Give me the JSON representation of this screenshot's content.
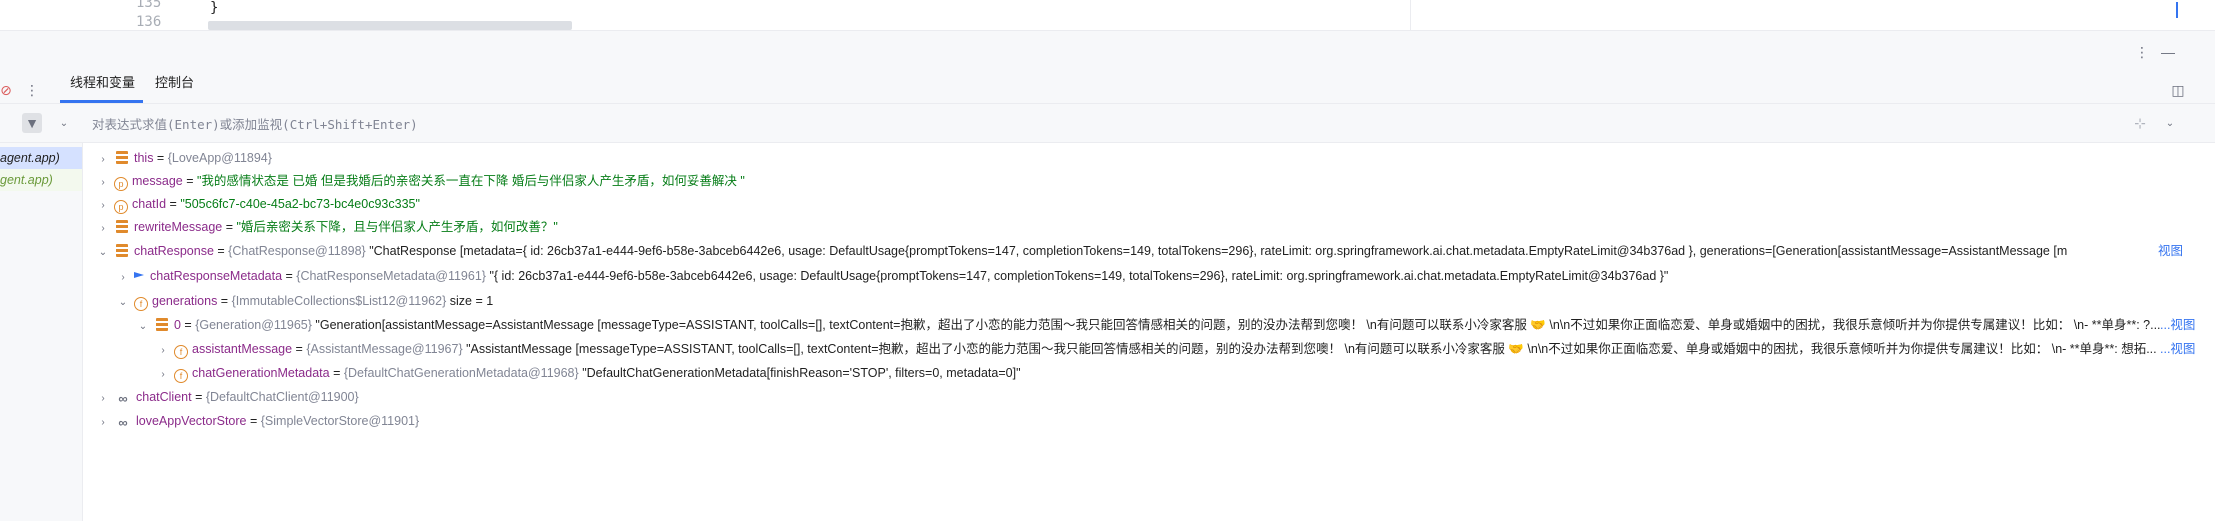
{
  "editor": {
    "line_numbers": [
      "135",
      "136"
    ],
    "code_text": "}"
  },
  "panel": {
    "tabs": [
      {
        "label": "线程和变量",
        "active": true
      },
      {
        "label": "控制台",
        "active": false
      }
    ],
    "expression_placeholder": "对表达式求值(Enter)或添加监视(Ctrl+Shift+Enter)"
  },
  "frames": [
    {
      "label": "agent.app)",
      "selected": true
    },
    {
      "label": "gent.app)",
      "selected": false
    }
  ],
  "variables": [
    {
      "name": "this",
      "type": "{LoveApp@11894}",
      "value": ""
    },
    {
      "name": "message",
      "type": "",
      "value": "\"我的感情状态是 已婚 但是我婚后的亲密关系一直在下降 婚后与伴侣家人产生矛盾，如何妥善解决 \""
    },
    {
      "name": "chatId",
      "type": "",
      "value": "\"505c6fc7-c40e-45a2-bc73-bc4e0c93c335\""
    },
    {
      "name": "rewriteMessage",
      "type": "",
      "value": "\"婚后亲密关系下降，且与伴侣家人产生矛盾，如何改善？\""
    },
    {
      "name": "chatResponse",
      "type": "{ChatResponse@11898}",
      "value": "\"ChatResponse [metadata={ id: 26cb37a1-e444-9ef6-b58e-3abceb6442e6, usage: DefaultUsage{promptTokens=147, completionTokens=149, totalTokens=296}, rateLimit: org.springframework.ai.chat.metadata.EmptyRateLimit@34b376ad }, generations=[Generation[assistantMessage=AssistantMessage [m"
    },
    {
      "name": "chatResponseMetadata",
      "type": "{ChatResponseMetadata@11961}",
      "value": "\"{ id: 26cb37a1-e444-9ef6-b58e-3abceb6442e6, usage: DefaultUsage{promptTokens=147, completionTokens=149, totalTokens=296}, rateLimit: org.springframework.ai.chat.metadata.EmptyRateLimit@34b376ad }\""
    },
    {
      "name": "generations",
      "type": "{ImmutableCollections$List12@11962}",
      "value": "size = 1"
    },
    {
      "name": "0",
      "type": "{Generation@11965}",
      "value": "\"Generation[assistantMessage=AssistantMessage [messageType=ASSISTANT, toolCalls=[], textContent=抱歉，超出了小恋的能力范围～我只能回答情感相关的问题，别的没办法帮到您噢！  \\n有问题可以联系小冷家客服 🤝 \\n\\n不过如果你正面临恋爱、单身或婚姻中的困扰，我很乐意倾听并为你提供专属建议！比如：  \\n- **单身**: ?..."
    },
    {
      "name": "assistantMessage",
      "type": "{AssistantMessage@11967}",
      "value": "\"AssistantMessage [messageType=ASSISTANT, toolCalls=[], textContent=抱歉，超出了小恋的能力范围～我只能回答情感相关的问题，别的没办法帮到您噢！  \\n有问题可以联系小冷家客服 🤝 \\n\\n不过如果你正面临恋爱、单身或婚姻中的困扰，我很乐意倾听并为你提供专属建议！比如：  \\n- **单身**: 想拓..."
    },
    {
      "name": "chatGenerationMetadata",
      "type": "{DefaultChatGenerationMetadata@11968}",
      "value": "\"DefaultChatGenerationMetadata[finishReason='STOP', filters=0, metadata=0]\""
    },
    {
      "name": "chatClient",
      "type": "{DefaultChatClient@11900}",
      "value": ""
    },
    {
      "name": "loveAppVectorStore",
      "type": "{SimpleVectorStore@11901}",
      "value": ""
    }
  ],
  "view_link": "...视图",
  "view_link_short": "视图",
  "colors": {
    "accent": "#3574f0",
    "string": "#067d17",
    "name": "#8b2b8a",
    "type": "#818594"
  }
}
